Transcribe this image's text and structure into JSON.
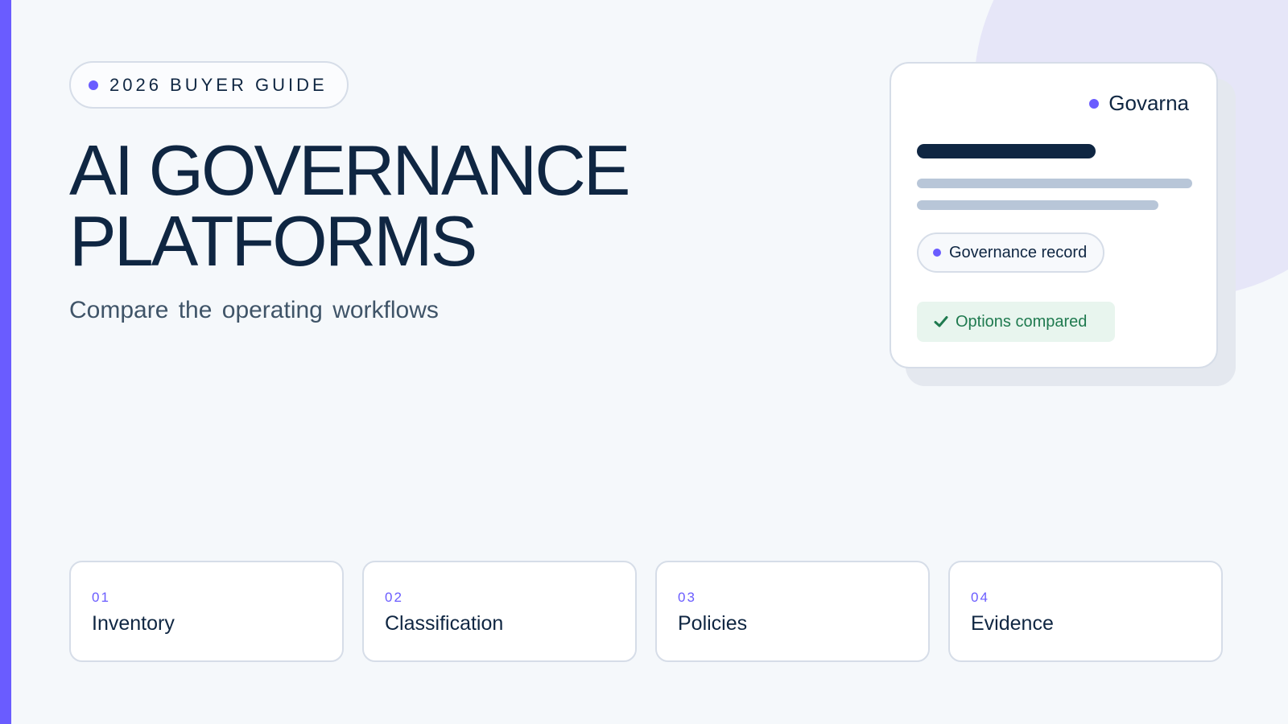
{
  "badge": {
    "text": "2026 BUYER GUIDE"
  },
  "hero": {
    "title_line1": "AI GOVERNANCE",
    "title_line2": "PLATFORMS",
    "subtitle": "Compare the operating workflows"
  },
  "preview_card": {
    "brand": "Govarna",
    "record_label": "Governance record",
    "status_label": "Options compared"
  },
  "steps": [
    {
      "num": "01",
      "label": "Inventory"
    },
    {
      "num": "02",
      "label": "Classification"
    },
    {
      "num": "03",
      "label": "Policies"
    },
    {
      "num": "04",
      "label": "Evidence"
    }
  ],
  "colors": {
    "accent": "#6a5cff",
    "navy": "#0f2642",
    "success": "#1f7a4f",
    "background": "#f5f8fb"
  }
}
